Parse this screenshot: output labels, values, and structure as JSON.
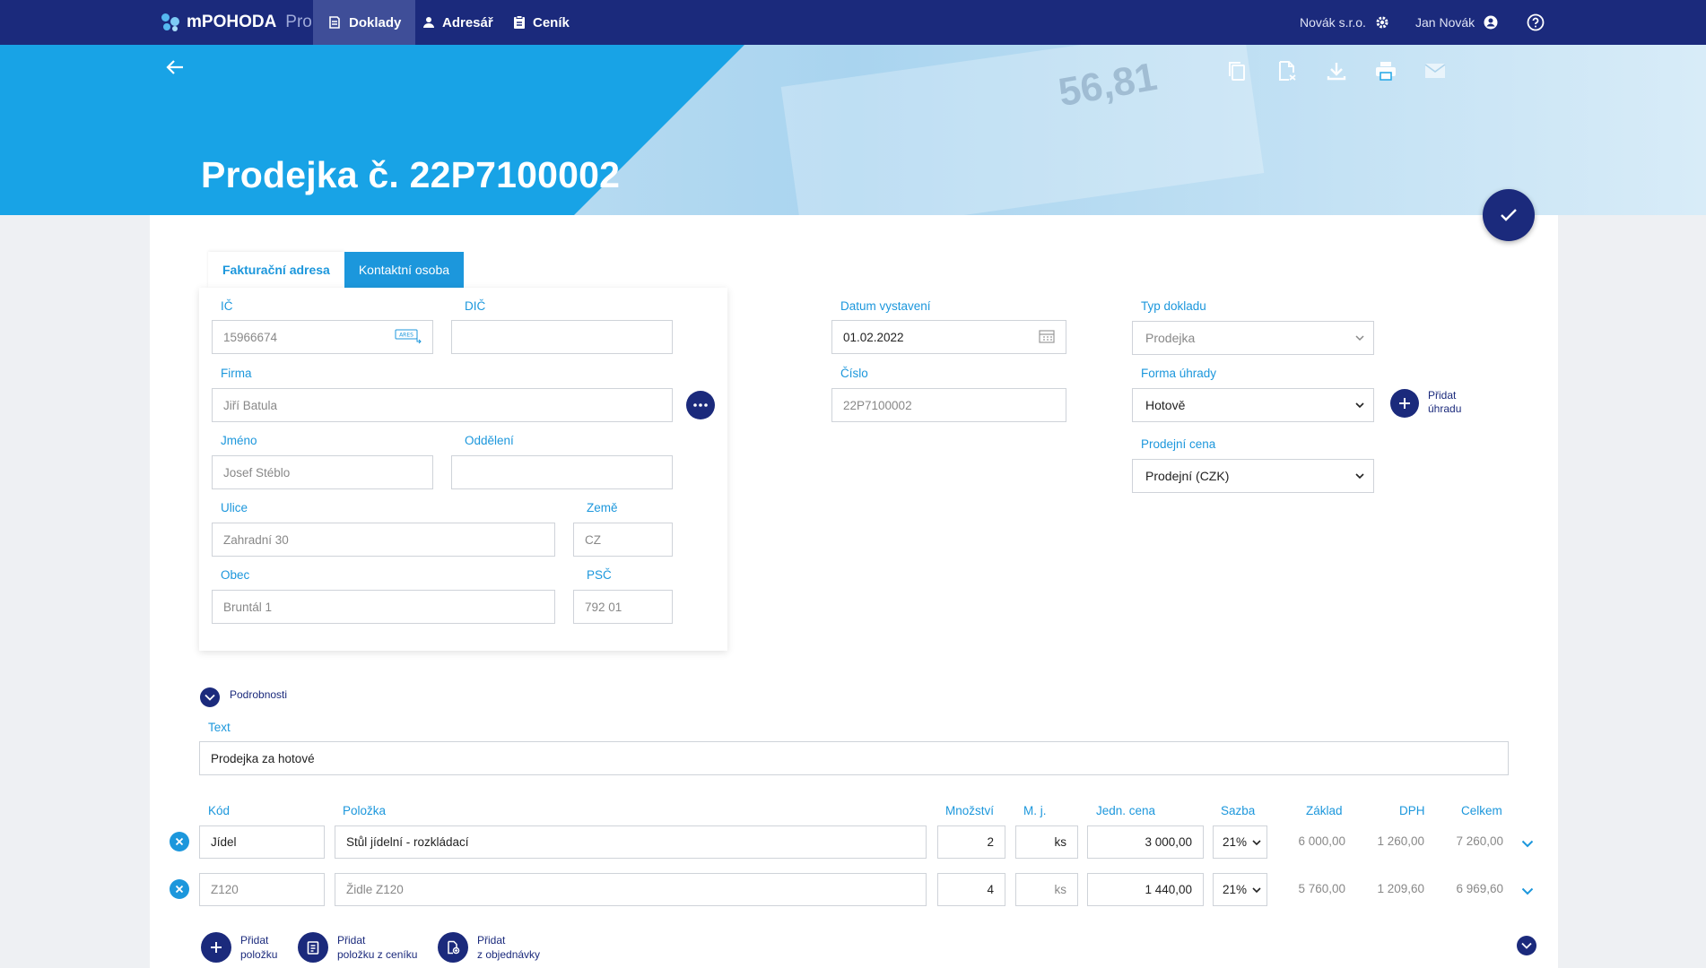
{
  "nav": {
    "brand": "mPOHODA",
    "brand_suffix": "Pro",
    "tabs": [
      {
        "label": "Doklady"
      },
      {
        "label": "Adresář"
      },
      {
        "label": "Ceník"
      }
    ],
    "company": "Novák s.r.o.",
    "user": "Jan Novák"
  },
  "banner": {
    "title": "Prodejka č. 22P7100002",
    "receipt_number": "56,81"
  },
  "tabs": [
    {
      "label": "Fakturační adresa"
    },
    {
      "label": "Kontaktní osoba"
    }
  ],
  "address": {
    "ic_label": "IČ",
    "ic_value": "15966674",
    "ares_label": "ARES",
    "dic_label": "DIČ",
    "dic_value": "",
    "firma_label": "Firma",
    "firma_value": "Jiří Batula",
    "jmeno_label": "Jméno",
    "jmeno_value": "Josef Stéblo",
    "oddeleni_label": "Oddělení",
    "oddeleni_value": "",
    "ulice_label": "Ulice",
    "ulice_value": "Zahradní 30",
    "zeme_label": "Země",
    "zeme_value": "CZ",
    "obec_label": "Obec",
    "obec_value": "Bruntál 1",
    "psc_label": "PSČ",
    "psc_value": "792 01"
  },
  "document": {
    "datum_label": "Datum vystavení",
    "datum_value": "01.02.2022",
    "cislo_label": "Číslo",
    "cislo_value": "22P7100002",
    "typ_label": "Typ dokladu",
    "typ_value": "Prodejka",
    "forma_label": "Forma úhrady",
    "forma_value": "Hotově",
    "pridat_uhradu_1": "Přidat",
    "pridat_uhradu_2": "úhradu",
    "cena_label": "Prodejní cena",
    "cena_value": "Prodejní (CZK)"
  },
  "details": {
    "toggle_label": "Podrobnosti",
    "text_label": "Text",
    "text_value": "Prodejka za hotové"
  },
  "items": {
    "headers": {
      "kod": "Kód",
      "polozka": "Položka",
      "mnozstvi": "Množství",
      "mj": "M. j.",
      "jedn_cena": "Jedn. cena",
      "sazba": "Sazba",
      "zaklad": "Základ",
      "dph": "DPH",
      "celkem": "Celkem"
    },
    "rows": [
      {
        "kod": "Jídel",
        "polozka": "Stůl jídelní - rozkládací",
        "mnozstvi": "2",
        "mj": "ks",
        "jedn_cena": "3 000,00",
        "sazba": "21%",
        "zaklad": "6 000,00",
        "dph": "1 260,00",
        "celkem": "7 260,00"
      },
      {
        "kod": "Z120",
        "polozka": "Židle Z120",
        "mnozstvi": "4",
        "mj": "ks",
        "jedn_cena": "1 440,00",
        "sazba": "21%",
        "zaklad": "5 760,00",
        "dph": "1 209,60",
        "celkem": "6 969,60"
      }
    ]
  },
  "actions": {
    "add_item_1": "Přidat",
    "add_item_2": "položku",
    "add_pricelist_1": "Přidat",
    "add_pricelist_2": "položku z ceníku",
    "add_order_1": "Přidat",
    "add_order_2": "z objednávky"
  }
}
